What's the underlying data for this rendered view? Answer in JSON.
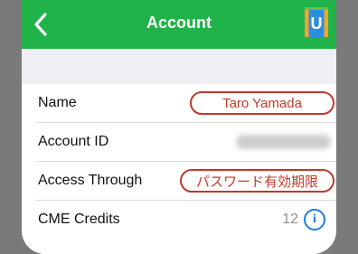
{
  "navbar": {
    "title": "Account",
    "back_icon": "chevron-left-icon",
    "logo_letter": "U",
    "color": "#20b34a"
  },
  "rows": [
    {
      "label": "Name",
      "value": "Taro Yamada"
    },
    {
      "label": "Account ID",
      "value": ""
    },
    {
      "label": "Access Through",
      "value": "パスワード有効期限"
    },
    {
      "label": "CME Credits",
      "value": "12",
      "icon": "info-icon"
    }
  ],
  "annotation_color": "#c0392b"
}
